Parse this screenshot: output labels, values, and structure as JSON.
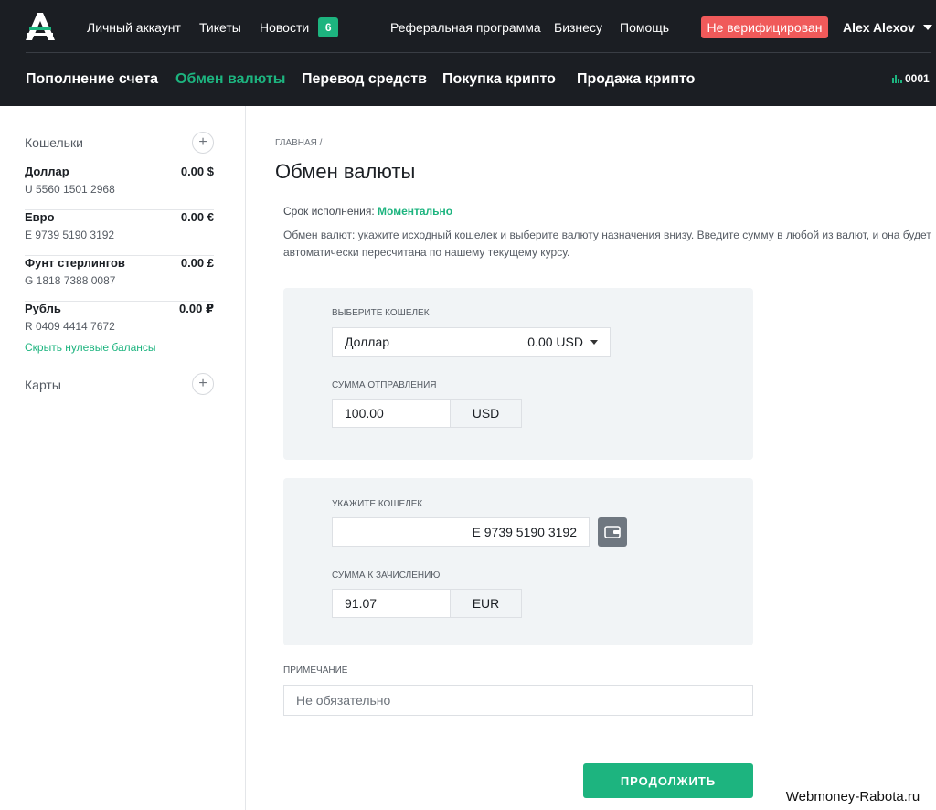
{
  "header": {
    "top_nav": [
      "Личный аккаунт",
      "Тикеты",
      "Новости"
    ],
    "news_count": "6",
    "right_nav": [
      "Реферальная программа",
      "Бизнесу",
      "Помощь"
    ],
    "unverified": "Не верифицирован",
    "user_name": "Alex Alexov",
    "main_nav": [
      "Пополнение счета",
      "Обмен валюты",
      "Перевод средств",
      "Покупка крипто",
      "Продажа крипто"
    ],
    "active_tab": "Обмен валюты",
    "account_id": "0001"
  },
  "sidebar": {
    "wallets_title": "Кошельки",
    "wallets": [
      {
        "name": "Доллар",
        "balance": "0.00 $",
        "number": "U 5560 1501 2968"
      },
      {
        "name": "Евро",
        "balance": "0.00 €",
        "number": "E 9739 5190 3192"
      },
      {
        "name": "Фунт стерлингов",
        "balance": "0.00 £",
        "number": "G 1818 7388 0087"
      },
      {
        "name": "Рубль",
        "balance": "0.00 ₽",
        "number": "R 0409 4414 7672"
      }
    ],
    "hide_zero": "Скрыть нулевые балансы",
    "cards_title": "Карты"
  },
  "main": {
    "breadcrumb": "ГЛАВНАЯ /",
    "title": "Обмен валюты",
    "term_label": "Срок исполнения:",
    "term_value": "Моментально",
    "description": "Обмен валют: укажите исходный кошелек и выберите валюту назначения внизу. Введите сумму в любой из валют, и она будет автоматически пересчитана по нашему текущему курсу.",
    "source": {
      "select_label": "ВЫБЕРИТЕ КОШЕЛЕК",
      "selected_wallet": "Доллар",
      "selected_balance": "0.00 USD",
      "amount_label": "СУММА ОТПРАВЛЕНИЯ",
      "amount": "100.00",
      "currency": "USD"
    },
    "target": {
      "wallet_label": "УКАЖИТЕ КОШЕЛЕК",
      "wallet_number": "E 9739 5190 3192",
      "amount_label": "СУММА К ЗАЧИСЛЕНИЮ",
      "amount": "91.07",
      "currency": "EUR"
    },
    "note_label": "ПРИМЕЧАНИЕ",
    "note_placeholder": "Не обязательно",
    "continue_label": "ПРОДОЛЖИТЬ"
  },
  "watermark": "Webmoney-Rabota.ru",
  "colors": {
    "accent": "#1db47f",
    "header_bg": "#1b1e23",
    "danger": "#f05a5a",
    "panel_bg": "#f1f4f6"
  },
  "icons": [
    "logo-icon",
    "chevron-down-icon",
    "stats-icon",
    "plus-icon",
    "wallet-icon"
  ]
}
